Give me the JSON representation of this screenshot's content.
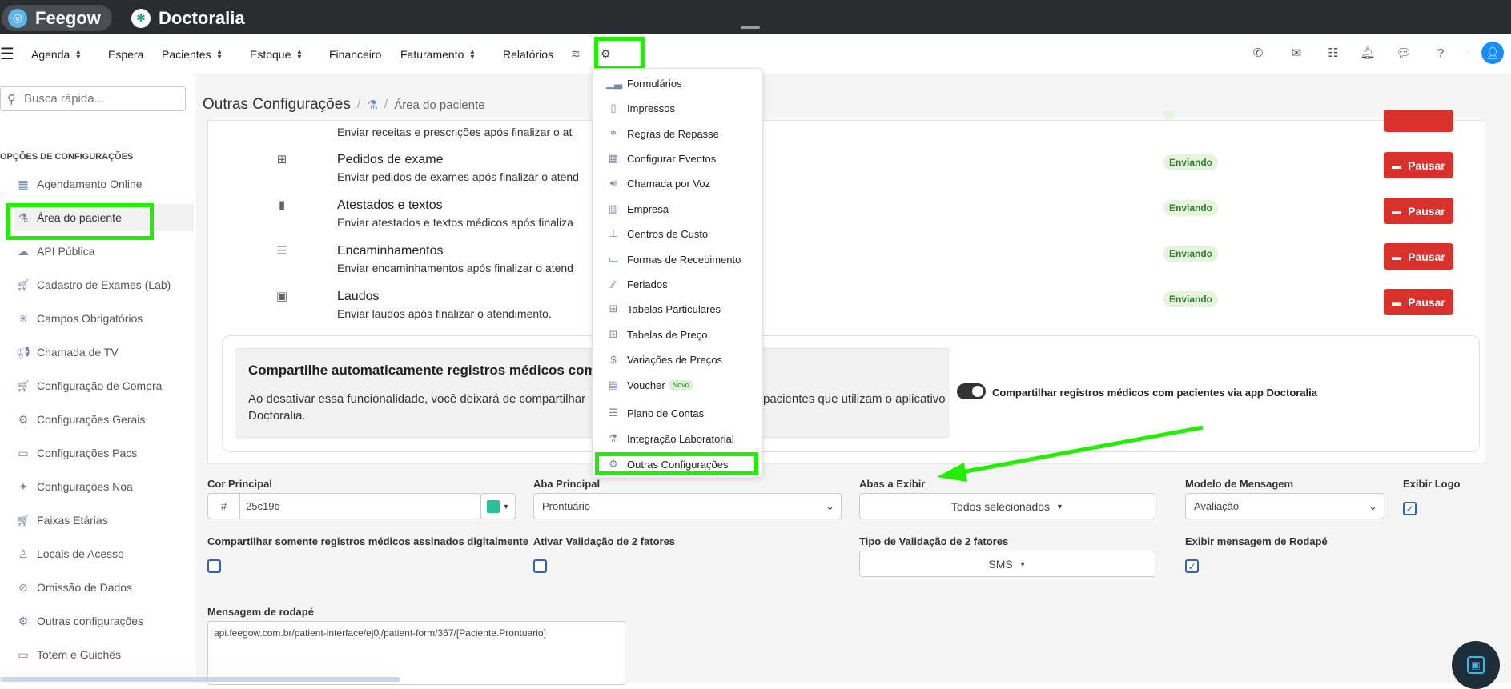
{
  "brand": {
    "feegow": "Feegow",
    "doctoralia": "Doctoralia"
  },
  "nav": {
    "agenda": "Agenda",
    "espera": "Espera",
    "pacientes": "Pacientes",
    "estoque": "Estoque",
    "financeiro": "Financeiro",
    "faturamento": "Faturamento",
    "relatorios": "Relatórios"
  },
  "search": {
    "placeholder": "Busca rápida..."
  },
  "sidebar": {
    "heading": "OPÇÕES DE CONFIGURAÇÕES",
    "items": [
      {
        "label": "Agendamento Online",
        "icon": "calendar-icon"
      },
      {
        "label": "Área do paciente",
        "icon": "flask-icon"
      },
      {
        "label": "API Pública",
        "icon": "cloud-icon"
      },
      {
        "label": "Cadastro de Exames (Lab)",
        "icon": "cart-icon"
      },
      {
        "label": "Campos Obrigatórios",
        "icon": "asterisk-icon"
      },
      {
        "label": "Chamada de TV",
        "icon": "megaphone-icon"
      },
      {
        "label": "Configuração de Compra",
        "icon": "cart-icon"
      },
      {
        "label": "Configurações Gerais",
        "icon": "gears-icon"
      },
      {
        "label": "Configurações Pacs",
        "icon": "laptop-icon"
      },
      {
        "label": "Configurações Noa",
        "icon": "sparkle-icon"
      },
      {
        "label": "Faixas Etárias",
        "icon": "cart-icon"
      },
      {
        "label": "Locais de Acesso",
        "icon": "user-icon"
      },
      {
        "label": "Omissão de Dados",
        "icon": "eye-slash-icon"
      },
      {
        "label": "Outras configurações",
        "icon": "gears-icon"
      },
      {
        "label": "Totem e Guichês",
        "icon": "laptop-icon"
      }
    ]
  },
  "breadcrumb": {
    "title": "Outras Configurações",
    "sub": "Área do paciente"
  },
  "rows": {
    "partial": {
      "desc": "Enviar receitas e prescrições após finalizar o at"
    },
    "items": [
      {
        "title": "Pedidos de exame",
        "desc": "Enviar pedidos de exames após finalizar o atend",
        "status": "Enviando",
        "action": "Pausar"
      },
      {
        "title": "Atestados e textos",
        "desc": "Enviar atestados e textos médicos após finaliza",
        "status": "Enviando",
        "action": "Pausar"
      },
      {
        "title": "Encaminhamentos",
        "desc": "Enviar encaminhamentos após finalizar o atend",
        "status": "Enviando",
        "action": "Pausar"
      },
      {
        "title": "Laudos",
        "desc": "Enviar laudos após finalizar o atendimento.",
        "status": "Enviando",
        "action": "Pausar"
      }
    ]
  },
  "share": {
    "title": "Compartilhe automaticamente registros médicos com se",
    "desc_a": "Ao desativar essa funcionalidade, você deixará de compartilhar",
    "desc_b": "pacientes que utilizam o aplicativo",
    "desc_c": "Doctoralia.",
    "toggle_label": "Compartilhar registros médicos com pacientes via app Doctoralia"
  },
  "form": {
    "cor_principal_label": "Cor Principal",
    "cor_prefix": "#",
    "cor_value": "25c19b",
    "cor_swatch": "#25c19b",
    "aba_principal_label": "Aba Principal",
    "aba_principal_value": "Prontuário",
    "abas_exibir_label": "Abas a Exibir",
    "abas_exibir_value": "Todos selecionados",
    "modelo_label": "Modelo de Mensagem",
    "modelo_value": "Avaliação",
    "exibir_logo_label": "Exibir Logo",
    "compartilhar_label": "Compartilhar somente registros médicos assinados digitalmente",
    "validacao_label": "Ativar Validação de 2 fatores",
    "tipo_validacao_label": "Tipo de Validação de 2 fatores",
    "tipo_validacao_value": "SMS",
    "rodape_label": "Exibir mensagem de Rodapé",
    "mensagem_rodape_label": "Mensagem de rodapé",
    "mensagem_rodape_value": "api.feegow.com.br/patient-interface/ej0j/patient-form/367/[Paciente.Prontuario]"
  },
  "menu": {
    "items": [
      {
        "label": "Formulários",
        "icon": "chart-icon"
      },
      {
        "label": "Impressos",
        "icon": "file-icon"
      },
      {
        "label": "Regras de Repasse",
        "icon": "handshake-icon"
      },
      {
        "label": "Configurar Eventos",
        "icon": "calendar-icon"
      },
      {
        "label": "Chamada por Voz",
        "icon": "speaker-icon"
      },
      {
        "label": "Empresa",
        "icon": "building-icon"
      },
      {
        "label": "Centros de Custo",
        "icon": "sitemap-icon"
      },
      {
        "label": "Formas de Recebimento",
        "icon": "card-icon"
      },
      {
        "label": "Feriados",
        "icon": "road-icon"
      },
      {
        "label": "Tabelas Particulares",
        "icon": "table-icon"
      },
      {
        "label": "Tabelas de Preço",
        "icon": "table-icon"
      },
      {
        "label": "Variações de Preços",
        "icon": "dollar-icon"
      },
      {
        "label": "Voucher",
        "icon": "ticket-icon",
        "badge": "Novo"
      },
      {
        "label": "Plano de Contas",
        "icon": "list-icon"
      },
      {
        "label": "Integração Laboratorial",
        "icon": "flask-icon"
      },
      {
        "label": "Outras Configurações",
        "icon": "gears-icon"
      }
    ]
  },
  "colors": {
    "accent_red": "#d9312b",
    "highlight_green": "#22ee00",
    "topbar": "#2a2d30"
  }
}
